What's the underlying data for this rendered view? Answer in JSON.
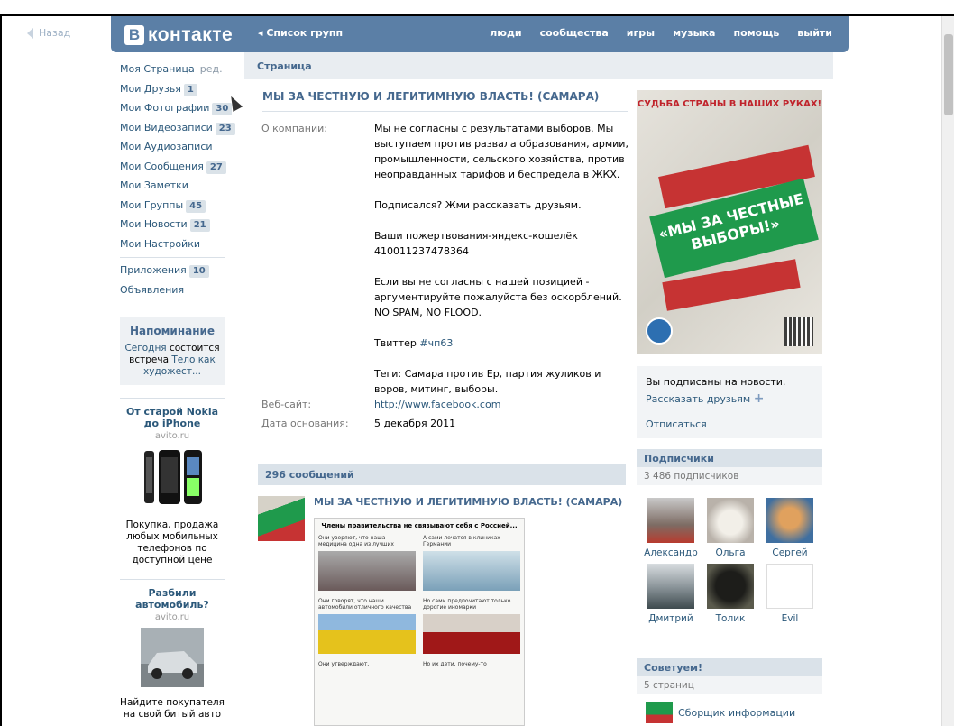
{
  "back": {
    "label": "Назад"
  },
  "header": {
    "logo_letter": "В",
    "logo_text": "контакте",
    "group_list": "◂ Список групп",
    "nav": [
      "люди",
      "сообщества",
      "игры",
      "музыка",
      "помощь",
      "выйти"
    ]
  },
  "sidebar": {
    "items": [
      {
        "label": "Моя Страница",
        "extra": "ред."
      },
      {
        "label": "Мои Друзья",
        "count": "1"
      },
      {
        "label": "Мои Фотографии",
        "count": "30"
      },
      {
        "label": "Мои Видеозаписи",
        "count": "23"
      },
      {
        "label": "Мои Аудиозаписи"
      },
      {
        "label": "Мои Сообщения",
        "count": "27"
      },
      {
        "label": "Мои Заметки"
      },
      {
        "label": "Мои Группы",
        "count": "45"
      },
      {
        "label": "Мои Новости",
        "count": "21"
      },
      {
        "label": "Мои Настройки"
      }
    ],
    "items2": [
      {
        "label": "Приложения",
        "count": "10"
      },
      {
        "label": "Объявления"
      }
    ],
    "reminder": {
      "title": "Напоминание",
      "today": "Сегодня",
      "text1": " состоится встреча ",
      "link": "Тело как художест..."
    },
    "ads": [
      {
        "title": "От старой Nokia до iPhone",
        "site": "avito.ru",
        "desc": "Покупка, продажа любых мобильных телефонов по доступной цене"
      },
      {
        "title": "Разбили автомобиль?",
        "site": "avito.ru",
        "desc": "Найдите покупателя на свой битый авто"
      }
    ]
  },
  "content": {
    "crumb": "Страница",
    "group_title": "МЫ ЗА ЧЕСТНУЮ И ЛЕГИТИМНУЮ ВЛАСТЬ! (САМАРА)",
    "about_label": "О компании:",
    "about": [
      "Мы не согласны с результатами выборов. Мы выступаем против развала образования, армии, промышленности, сельского хозяйства, против неоправданных тарифов и беспредела в ЖКХ.",
      "Подписался? Жми рассказать друзьям.",
      "Ваши пожертвования-яндекс-кошелёк 410011237478364",
      "Если вы не согласны с нашей позицией - аргументируйте пожалуйста без оскорблений. NO SPAM, NO FLOOD."
    ],
    "twitter_prefix": "Твиттер ",
    "twitter_tag": "#чп63",
    "tags": "Теги: Самара против Ер, партия жуликов и воров, митинг, выборы.",
    "website_label": "Веб-сайт:",
    "website": "http://www.facebook.com",
    "founded_label": "Дата основания:",
    "founded": "5 декабря 2011",
    "wall_count": "296 сообщений",
    "post_title": "МЫ ЗА ЧЕСТНУЮ И ЛЕГИТИМНУЮ ВЛАСТЬ! (САМАРА)",
    "post_image": {
      "heading": "Члены правительства не связывают себя с Россией...",
      "captions": [
        "Они уверяют, что наша медицина одна из лучших",
        "А сами лечатся в клиниках Германии",
        "Они говорят, что наши автомобили отличного качества",
        "Но сами предпочитают только дорогие иномарки",
        "Они утверждают,",
        "Но их дети, почему-то"
      ]
    }
  },
  "right": {
    "poster_title": "СУДЬБА СТРАНЫ В НАШИХ РУКАХ!",
    "poster_slogan": "«МЫ ЗА ЧЕСТНЫЕ ВЫБОРЫ!»",
    "subscribed": "Вы подписаны на новости.",
    "tell_friends": "Рассказать друзьям",
    "unsubscribe": "Отписаться",
    "subs_title": "Подписчики",
    "subs_count": "3 486 подписчиков",
    "subscribers": [
      {
        "name": "Александр",
        "color": "#8a7f78"
      },
      {
        "name": "Ольга",
        "color": "#c9c4c8"
      },
      {
        "name": "Сергей",
        "color": "#d08a3a"
      },
      {
        "name": "Дмитрий",
        "color": "#9aa4a8"
      },
      {
        "name": "Толик",
        "color": "#2a2a26"
      },
      {
        "name": "Evil",
        "color": "#f4f4f4"
      }
    ],
    "recommend_title": "Советуем!",
    "recommend_count": "5 страниц",
    "recommend_item": "Сборщик информации"
  },
  "colors": {
    "header": "#5b7fa6",
    "link": "#2b587a",
    "accent": "#45688e"
  }
}
